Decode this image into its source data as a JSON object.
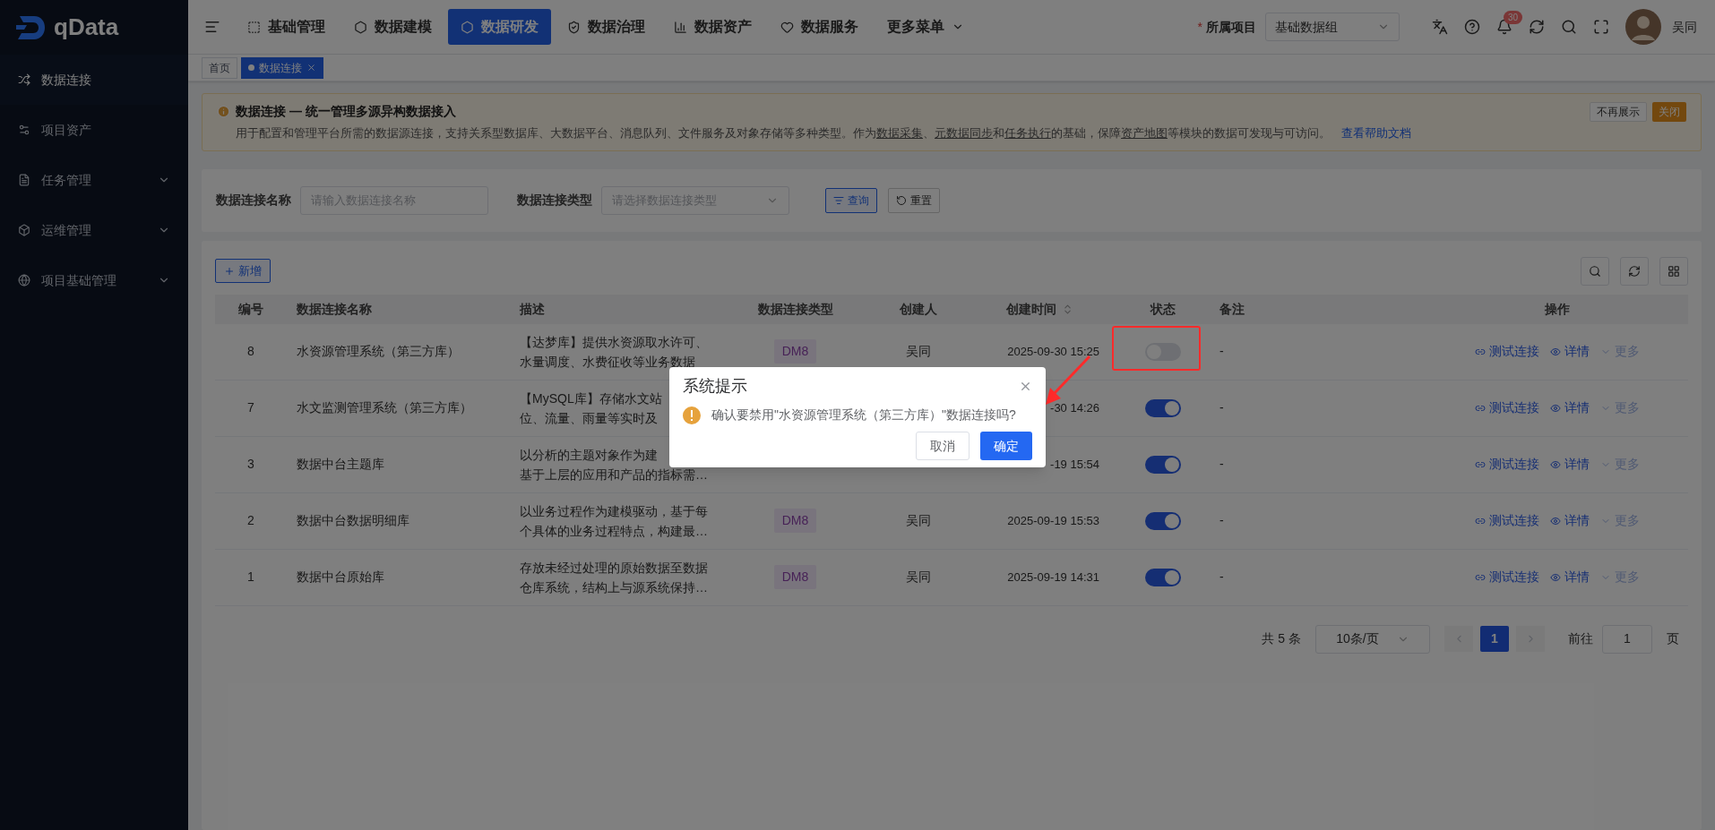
{
  "brand": {
    "name": "qData"
  },
  "sidebar": {
    "items": [
      {
        "label": "数据连接",
        "selected": true,
        "expandable": false
      },
      {
        "label": "项目资产",
        "selected": false,
        "expandable": false
      },
      {
        "label": "任务管理",
        "selected": false,
        "expandable": true
      },
      {
        "label": "运维管理",
        "selected": false,
        "expandable": true
      },
      {
        "label": "项目基础管理",
        "selected": false,
        "expandable": true
      }
    ]
  },
  "top_nav": {
    "items": [
      {
        "label": "基础管理",
        "selected": false,
        "dropdown": false
      },
      {
        "label": "数据建模",
        "selected": false,
        "dropdown": false
      },
      {
        "label": "数据研发",
        "selected": true,
        "dropdown": false
      },
      {
        "label": "数据治理",
        "selected": false,
        "dropdown": false
      },
      {
        "label": "数据资产",
        "selected": false,
        "dropdown": false
      },
      {
        "label": "数据服务",
        "selected": false,
        "dropdown": false
      },
      {
        "label": "更多菜单",
        "selected": false,
        "dropdown": true
      }
    ]
  },
  "project": {
    "label": "所属项目",
    "required_mark": "*",
    "value": "基础数据组"
  },
  "notifications": {
    "count": "30"
  },
  "user": {
    "name": "吴同"
  },
  "tabs": [
    {
      "label": "首页",
      "selected": false,
      "closable": false
    },
    {
      "label": "数据连接",
      "selected": true,
      "closable": true
    }
  ],
  "banner": {
    "title": "数据连接 — 统一管理多源异构数据接入",
    "segments": [
      {
        "kind": "text",
        "text": "用于配置和管理平台所需的数据源连接，支持关系型数据库、大数据平台、消息队列、文件服务及对象存储等多种类型。作为"
      },
      {
        "kind": "link",
        "text": "数据采集"
      },
      {
        "kind": "text",
        "text": "、"
      },
      {
        "kind": "link",
        "text": "元数据同步"
      },
      {
        "kind": "text",
        "text": "和"
      },
      {
        "kind": "link",
        "text": "任务执行"
      },
      {
        "kind": "text",
        "text": "的基础，保障"
      },
      {
        "kind": "link",
        "text": "资产地图"
      },
      {
        "kind": "text",
        "text": "等模块的数据可发现与可访问。"
      }
    ],
    "help_link": "查看帮助文档",
    "buttons": [
      "不再展示",
      "关闭"
    ]
  },
  "filters": [
    {
      "kind": "input",
      "label": "数据连接名称",
      "placeholder": "请输入数据连接名称"
    },
    {
      "kind": "select",
      "label": "数据连接类型",
      "placeholder": "请选择数据连接类型"
    }
  ],
  "filter_buttons": [
    "查询",
    "重置"
  ],
  "add_button": "新增",
  "table": {
    "columns": [
      {
        "label": "编号"
      },
      {
        "label": "数据连接名称"
      },
      {
        "label": "描述"
      },
      {
        "label": "数据连接类型"
      },
      {
        "label": "创建人"
      },
      {
        "label": "创建时间",
        "sortable": true
      },
      {
        "label": "状态"
      },
      {
        "label": "备注"
      },
      {
        "label": "操作"
      }
    ],
    "rows": [
      {
        "id": "8",
        "name": "水资源管理系统（第三方库）",
        "description": [
          "【达梦库】提供水资源取水许可、",
          "水量调度、水费征收等业务数据"
        ],
        "type": "DM8",
        "creator": "吴同",
        "created": "2025-09-30 15:25",
        "enabled": false,
        "note": "-",
        "actions": [
          "测试连接",
          "详情",
          "更多"
        ]
      },
      {
        "id": "7",
        "name": "水文监测管理系统（第三方库）",
        "description": [
          "【MySQL库】存储水文站",
          "位、流量、雨量等实时及"
        ],
        "created": "-30 14:26",
        "enabled": true,
        "note": "-",
        "actions": [
          "测试连接",
          "详情",
          "更多"
        ]
      },
      {
        "id": "3",
        "name": "数据中台主题库",
        "description": [
          "以分析的主题对象作为建",
          "基于上层的应用和产品的指标需…"
        ],
        "created": "-19 15:54",
        "enabled": true,
        "note": "-",
        "actions": [
          "测试连接",
          "详情",
          "更多"
        ]
      },
      {
        "id": "2",
        "name": "数据中台数据明细库",
        "description": [
          "以业务过程作为建模驱动，基于每",
          "个具体的业务过程特点，构建最…"
        ],
        "type": "DM8",
        "creator": "吴同",
        "created": "2025-09-19 15:53",
        "enabled": true,
        "note": "-",
        "actions": [
          "测试连接",
          "详情",
          "更多"
        ]
      },
      {
        "id": "1",
        "name": "数据中台原始库",
        "description": [
          "存放未经过处理的原始数据至数据",
          "仓库系统，结构上与源系统保持…"
        ],
        "type": "DM8",
        "creator": "吴同",
        "created": "2025-09-19 14:31",
        "enabled": true,
        "note": "-",
        "actions": [
          "测试连接",
          "详情",
          "更多"
        ]
      }
    ]
  },
  "pagination": {
    "total": "共 5 条",
    "page_size": "10条/页",
    "pages": [
      {
        "label": "1",
        "selected": true
      }
    ],
    "goto_label": "前往",
    "goto_value": "1",
    "page_suffix": "页"
  },
  "dialog": {
    "title": "系统提示",
    "message": "确认要禁用\"水资源管理系统（第三方库）\"数据连接吗?",
    "buttons": [
      "取消",
      "确定"
    ]
  }
}
